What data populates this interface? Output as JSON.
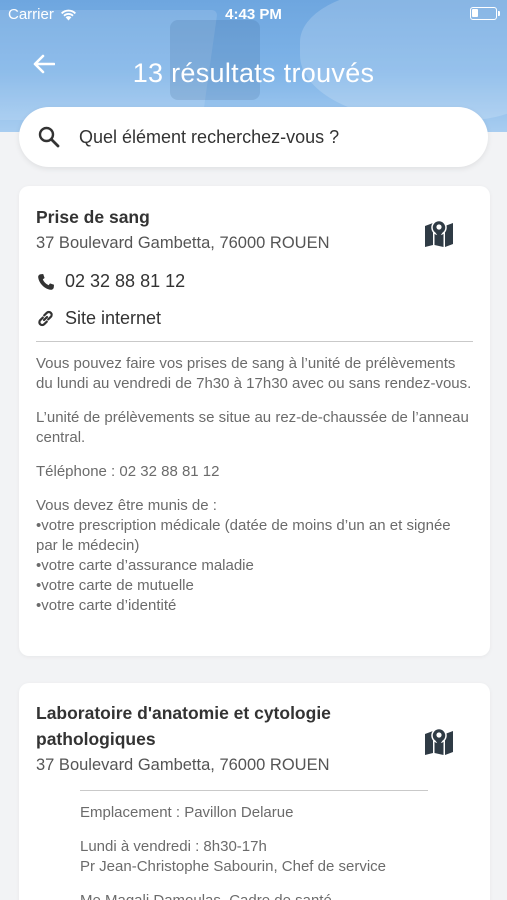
{
  "status_bar": {
    "carrier": "Carrier",
    "time": "4:43 PM"
  },
  "header": {
    "title": "13 résultats trouvés",
    "back_icon": "arrow-left-icon"
  },
  "search": {
    "placeholder": "Quel élément recherchez-vous ?",
    "icon": "search-icon"
  },
  "results": [
    {
      "title": "Prise de sang",
      "address": "37 Boulevard Gambetta, 76000 ROUEN",
      "phone": "02 32 88 81 12",
      "website_label": "Site internet",
      "description": {
        "p1": "Vous pouvez faire vos prises de sang à l’unité de prélèvements du lundi au vendredi de 7h30 à 17h30 avec ou sans rendez-vous.",
        "p2": "L’unité de prélèvements se situe au rez-de-chaussée de l’anneau central.",
        "p3": "Téléphone : 02 32 88 81 12",
        "p4_intro": "Vous devez être munis de :",
        "p4_items": [
          "•votre prescription médicale (datée de moins d’un an et signée par le médecin)",
          "•votre carte d’assurance maladie",
          "•votre carte de mutuelle",
          "•votre carte d’identité"
        ]
      }
    },
    {
      "title": "Laboratoire d'anatomie et cytologie pathologiques",
      "address": "37 Boulevard Gambetta, 76000 ROUEN",
      "description": {
        "p1": "Emplacement : Pavillon Delarue",
        "p2_line1": "Lundi à vendredi : 8h30-17h",
        "p2_line2": "Pr Jean-Christophe Sabourin, Chef de service",
        "p3": "Me Magali Damoulas, Cadre de santé"
      }
    }
  ],
  "colors": {
    "header_blue": "#7fb4e8",
    "background": "#f2f3f5",
    "card": "#ffffff",
    "text_dark": "#333333",
    "text_muted": "#6b6b6b"
  }
}
